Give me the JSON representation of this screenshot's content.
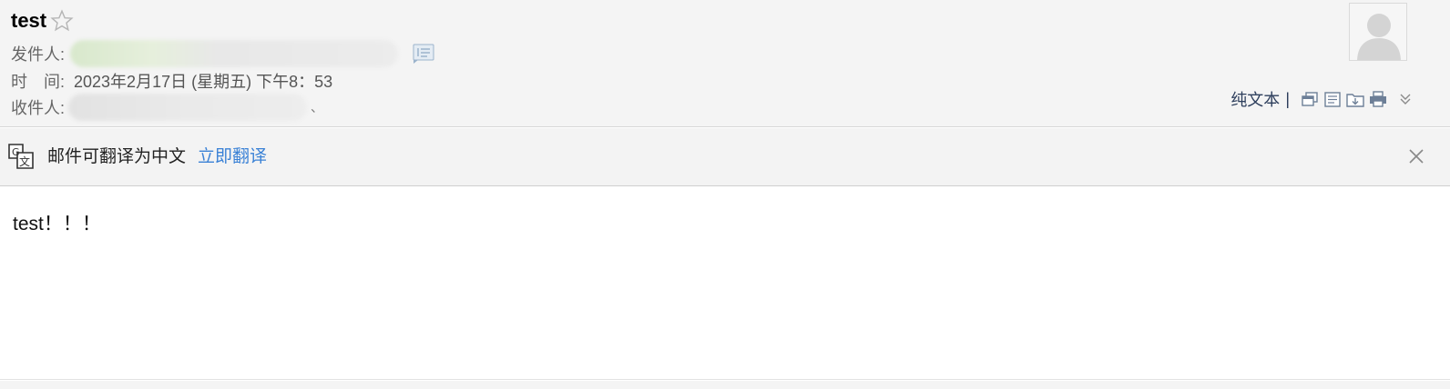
{
  "header": {
    "subject": "test",
    "sender_label": "发件人:",
    "time_label": "时　间:",
    "time_value": "2023年2月17日 (星期五) 下午8：53",
    "recipient_label": "收件人:",
    "recipient_suffix": "、"
  },
  "tools": {
    "plain_text": "纯文本",
    "separator": "|"
  },
  "translate": {
    "prompt": "邮件可翻译为中文",
    "action": "立即翻译"
  },
  "body": {
    "text": "test！！！"
  },
  "colors": {
    "link": "#3b82d6",
    "header_bg": "#f4f4f4",
    "tool_text": "#2d3e5c"
  }
}
